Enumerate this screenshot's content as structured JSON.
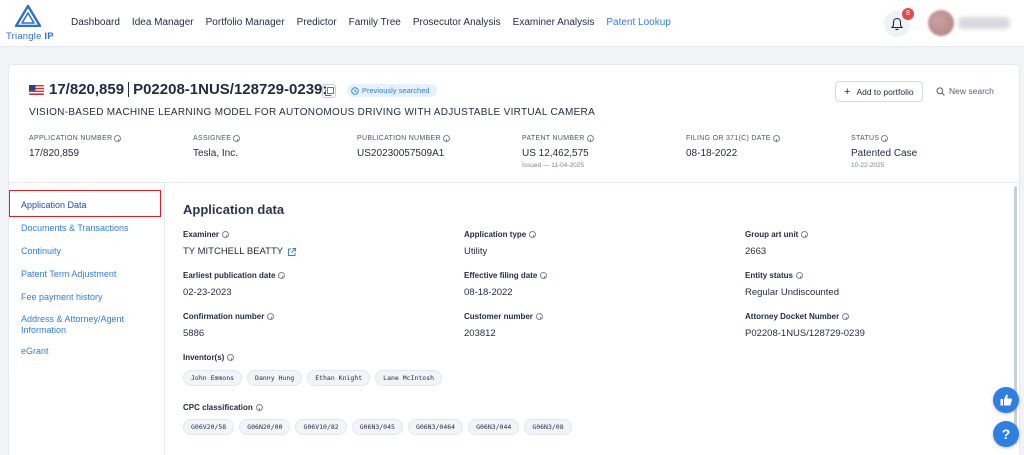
{
  "app": {
    "logo_text_brand": "Triangle",
    "logo_text_suffix": "IP"
  },
  "nav": {
    "items": [
      {
        "label": "Dashboard",
        "active": false
      },
      {
        "label": "Idea Manager",
        "active": false
      },
      {
        "label": "Portfolio Manager",
        "active": false
      },
      {
        "label": "Predictor",
        "active": false
      },
      {
        "label": "Family Tree",
        "active": false
      },
      {
        "label": "Prosecutor Analysis",
        "active": false
      },
      {
        "label": "Examiner Analysis",
        "active": false
      },
      {
        "label": "Patent Lookup",
        "active": true
      }
    ],
    "notification_count": "8"
  },
  "header": {
    "application_no": "17/820,859",
    "docket": "P02208-1NUS/128729-0239:",
    "previously_searched": "Previously searched",
    "title": "VISION-BASED MACHINE LEARNING MODEL FOR AUTONOMOUS DRIVING WITH ADJUSTABLE VIRTUAL CAMERA",
    "add_to_portfolio": "Add to portfolio",
    "new_search": "New search"
  },
  "summary": [
    {
      "label": "APPLICATION NUMBER",
      "value": "17/820,859",
      "sub": ""
    },
    {
      "label": "ASSIGNEE",
      "value": "Tesla, Inc.",
      "sub": ""
    },
    {
      "label": "PUBLICATION NUMBER",
      "value": "US20230057509A1",
      "sub": ""
    },
    {
      "label": "PATENT NUMBER",
      "value": "US 12,462,575",
      "sub": "Issued — 11-04-2025"
    },
    {
      "label": "FILING OR 371(C) DATE",
      "value": "08-18-2022",
      "sub": ""
    },
    {
      "label": "STATUS",
      "value": "Patented Case",
      "sub": "10-22-2025"
    }
  ],
  "sidebar": {
    "items": [
      {
        "label": "Application Data",
        "active": true
      },
      {
        "label": "Documents & Transactions",
        "active": false
      },
      {
        "label": "Continuity",
        "active": false
      },
      {
        "label": "Patent Term Adjustment",
        "active": false
      },
      {
        "label": "Fee payment history",
        "active": false
      },
      {
        "label": "Address & Attorney/Agent Information",
        "active": false
      },
      {
        "label": "eGrant",
        "active": false
      }
    ]
  },
  "main": {
    "section_title": "Application data",
    "fields": [
      {
        "label": "Examiner",
        "value": "TY MITCHELL BEATTY",
        "link": true
      },
      {
        "label": "Application type",
        "value": "Utility"
      },
      {
        "label": "Group art unit",
        "value": "2663"
      },
      {
        "label": "Earliest publication date",
        "value": "02-23-2023"
      },
      {
        "label": "Effective filing date",
        "value": "08-18-2022"
      },
      {
        "label": "Entity status",
        "value": "Regular Undiscounted"
      },
      {
        "label": "Confirmation number",
        "value": "5886"
      },
      {
        "label": "Customer number",
        "value": "203812"
      },
      {
        "label": "Attorney Docket Number",
        "value": "P02208-1NUS/128729-0239"
      }
    ],
    "inventors_label": "Inventor(s)",
    "inventors": [
      "John Emmons",
      "Danny Hung",
      "Ethan Knight",
      "Lane McIntosh"
    ],
    "cpc_label": "CPC classification",
    "cpc": [
      "G06V20/58",
      "G06N20/00",
      "G06V10/82",
      "G06N3/045",
      "G06N3/0464",
      "G06N3/044",
      "G06N3/08"
    ]
  },
  "colors": {
    "accent": "#2f7fe0",
    "active_outline": "#e11d2a",
    "badge": "#e5484d"
  },
  "icons": [
    "triangle-logo-icon",
    "bell-icon",
    "us-flag-icon",
    "copy-icon",
    "clock-icon",
    "plus-icon",
    "search-icon",
    "info-icon",
    "external-link-icon",
    "thumbs-up-icon",
    "help-icon"
  ]
}
